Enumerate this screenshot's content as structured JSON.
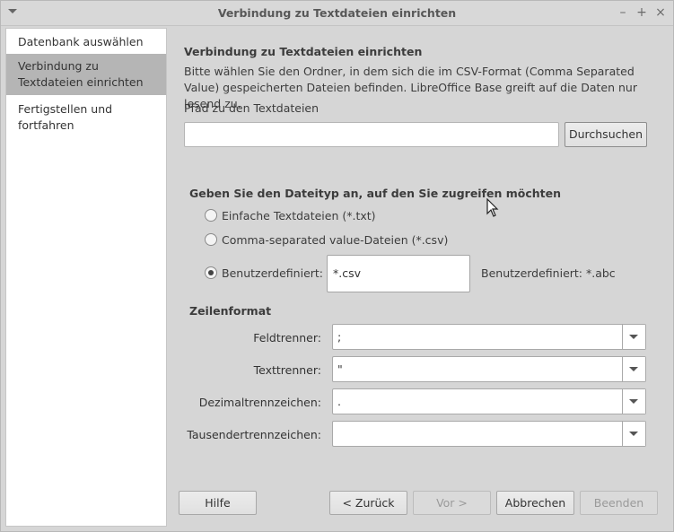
{
  "window": {
    "title": "Verbindung zu Textdateien einrichten"
  },
  "sidebar": {
    "items": [
      {
        "label": "Datenbank auswählen"
      },
      {
        "label": "Verbindung zu Textdateien einrichten",
        "active": true
      },
      {
        "label": "Fertigstellen und fortfahren"
      }
    ]
  },
  "main": {
    "heading": "Verbindung zu Textdateien einrichten",
    "description": "Bitte wählen Sie den Ordner, in dem sich die im CSV-Format (Comma Separated Value) gespeicherten Dateien befinden. LibreOffice Base greift auf die Daten nur lesend zu.",
    "path_label": "Pfad zu den Textdateien",
    "path_value": "",
    "browse_label": "Durchsuchen",
    "filetype_heading": "Geben Sie den Dateityp an, auf den Sie zugreifen möchten",
    "filetype_options": [
      {
        "label": "Einfache Textdateien (*.txt)",
        "selected": false
      },
      {
        "label": "Comma-separated value-Dateien (*.csv)",
        "selected": false
      },
      {
        "label": "Benutzerdefiniert:",
        "selected": true
      }
    ],
    "custom_value": "*.csv",
    "custom_hint": "Benutzerdefiniert: *.abc",
    "rowformat_heading": "Zeilenformat",
    "fields": [
      {
        "label": "Feldtrenner:",
        "value": ";"
      },
      {
        "label": "Texttrenner:",
        "value": "\""
      },
      {
        "label": "Dezimaltrennzeichen:",
        "value": "."
      },
      {
        "label": "Tausendertrennzeichen:",
        "value": ""
      }
    ]
  },
  "buttons": {
    "help": "Hilfe",
    "back": "< Zurück",
    "next": "Vor >",
    "cancel": "Abbrechen",
    "finish": "Beenden"
  },
  "icons": {
    "window_menu": "chevron-down-icon",
    "minimize": "minimize-icon",
    "maximize": "maximize-icon",
    "close": "close-icon",
    "cursor": "mouse-pointer-icon"
  }
}
